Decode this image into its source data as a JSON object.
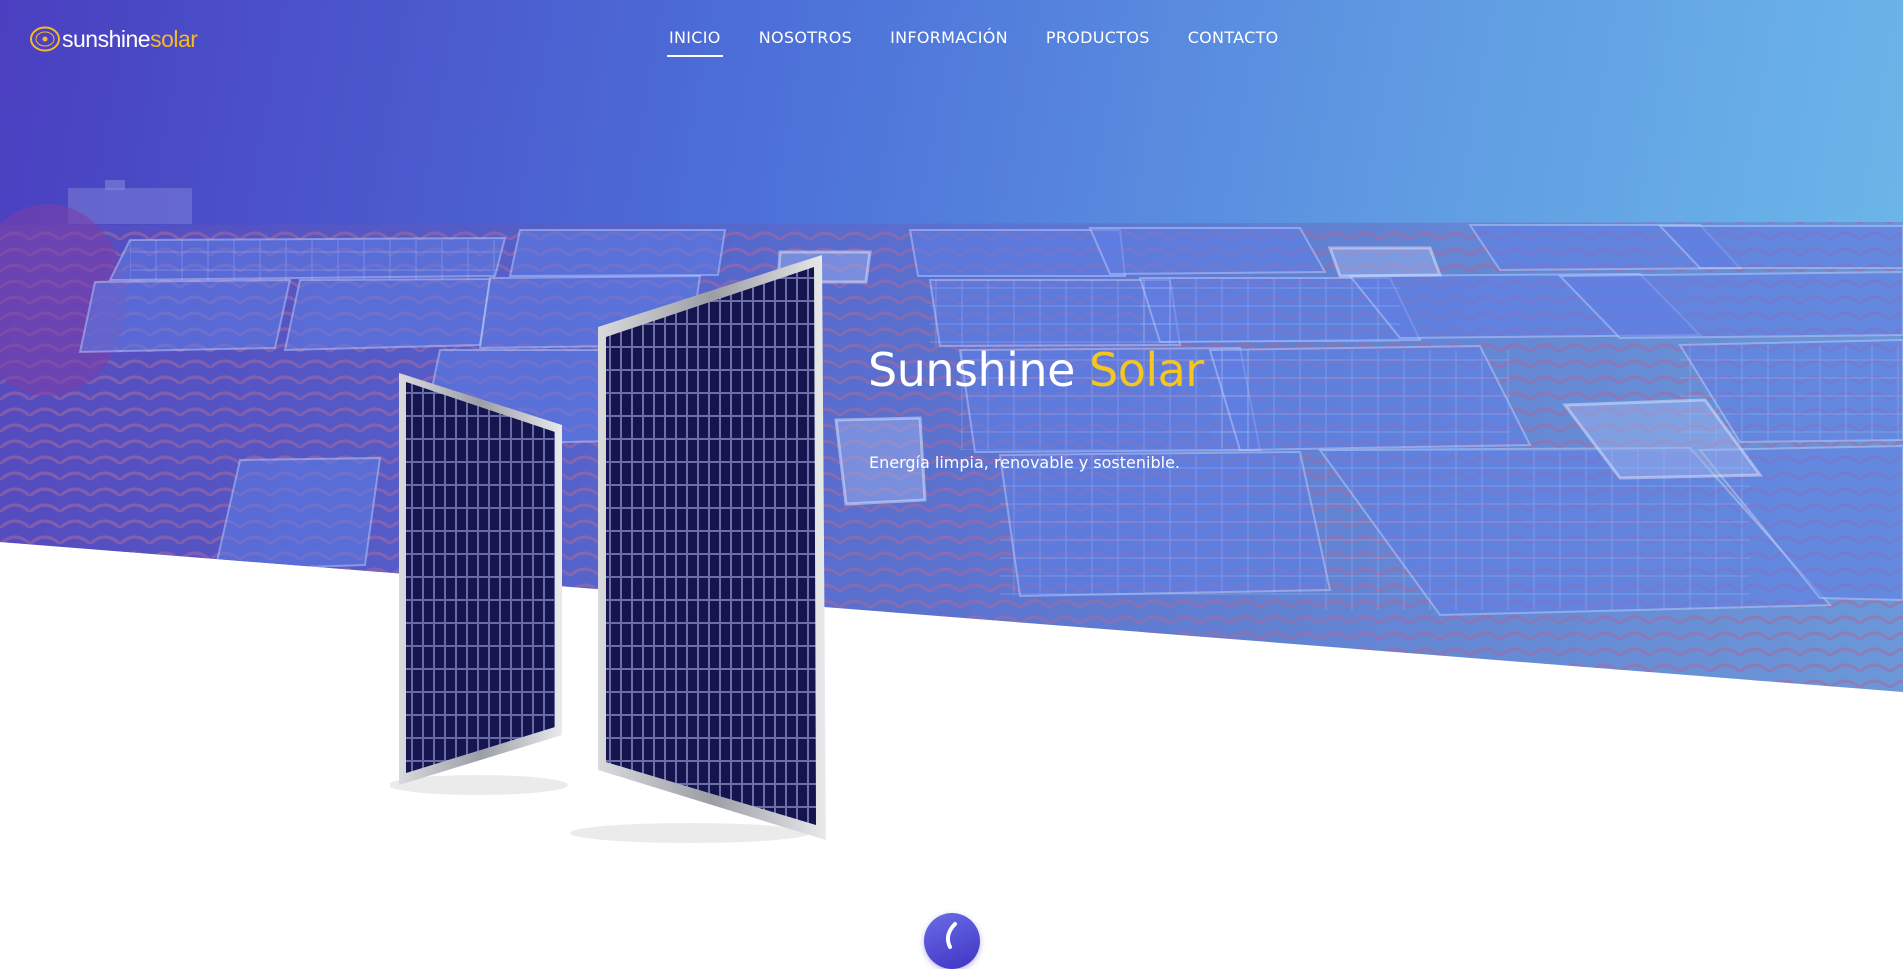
{
  "brand": {
    "logo_part1": "sunshine",
    "logo_part2": "solar",
    "accent_color": "#f4b82a"
  },
  "nav": {
    "items": [
      {
        "label": "INICIO",
        "active": true
      },
      {
        "label": "NOSOTROS",
        "active": false
      },
      {
        "label": "INFORMACIÓN",
        "active": false
      },
      {
        "label": "PRODUCTOS",
        "active": false
      },
      {
        "label": "CONTACTO",
        "active": false
      }
    ]
  },
  "hero": {
    "title_part1": "Sunshine",
    "title_part2": "Solar",
    "subtitle": "Energía limpia, renovable y sostenible.",
    "gradient_start": "#4a3fc0",
    "gradient_end": "#6dbaea",
    "title_accent_color": "#f4c61f"
  },
  "product": {
    "image": "solar-panels-pair"
  },
  "scroll_badge": {
    "icon": "scroll-down-icon"
  }
}
